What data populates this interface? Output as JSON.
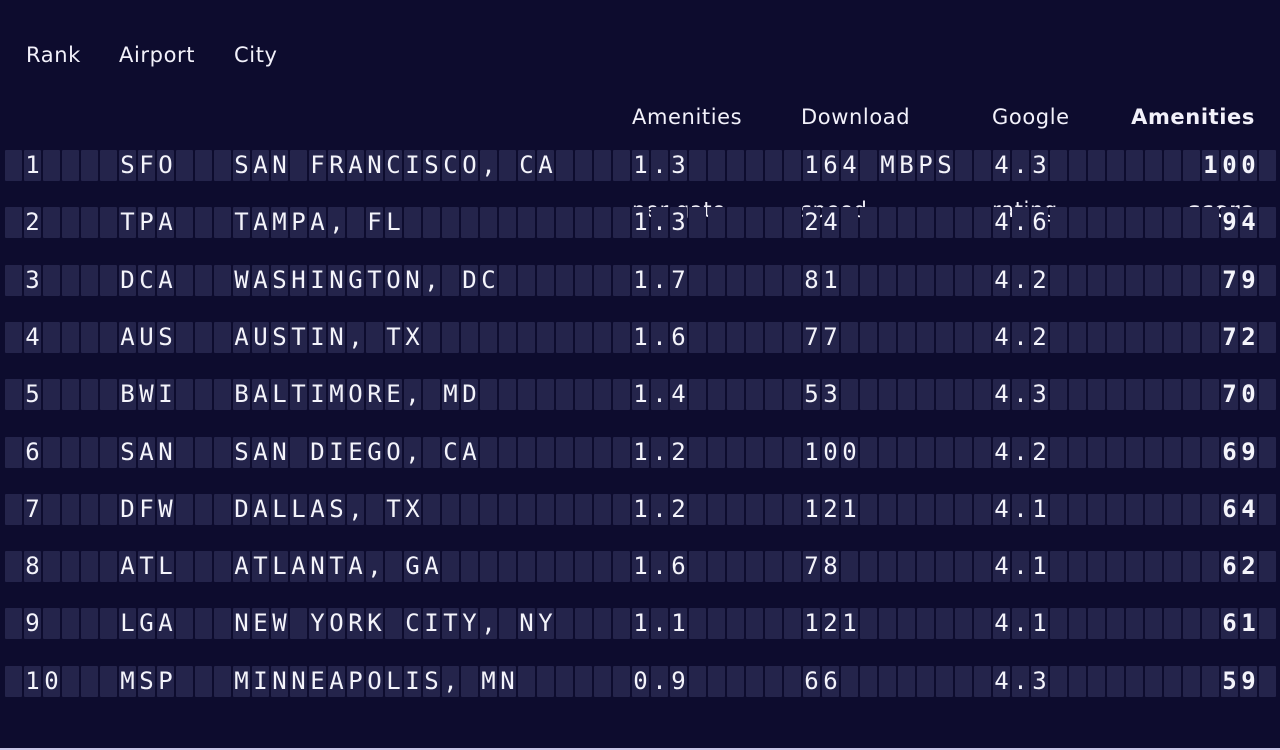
{
  "header": {
    "rank": "Rank",
    "airport": "Airport",
    "city": "City",
    "amenities_per_gate": [
      "Amenities",
      "per gate"
    ],
    "download_speed": [
      "Download",
      "speed"
    ],
    "google_rating": [
      "Google",
      "rating"
    ],
    "amenities_score": [
      "Amenities",
      "score"
    ]
  },
  "download_unit": "MBPS",
  "rows": [
    {
      "rank": "1",
      "airport": "SFO",
      "city": "SAN FRANCISCO, CA",
      "amenities_per_gate": "1.3",
      "download_speed": "164 MBPS",
      "google_rating": "4.3",
      "amenities_score": "100"
    },
    {
      "rank": "2",
      "airport": "TPA",
      "city": "TAMPA, FL",
      "amenities_per_gate": "1.3",
      "download_speed": "24",
      "google_rating": "4.6",
      "amenities_score": "94"
    },
    {
      "rank": "3",
      "airport": "DCA",
      "city": "WASHINGTON, DC",
      "amenities_per_gate": "1.7",
      "download_speed": "81",
      "google_rating": "4.2",
      "amenities_score": "79"
    },
    {
      "rank": "4",
      "airport": "AUS",
      "city": "AUSTIN, TX",
      "amenities_per_gate": "1.6",
      "download_speed": "77",
      "google_rating": "4.2",
      "amenities_score": "72"
    },
    {
      "rank": "5",
      "airport": "BWI",
      "city": "BALTIMORE, MD",
      "amenities_per_gate": "1.4",
      "download_speed": "53",
      "google_rating": "4.3",
      "amenities_score": "70"
    },
    {
      "rank": "6",
      "airport": "SAN",
      "city": "SAN DIEGO, CA",
      "amenities_per_gate": "1.2",
      "download_speed": "100",
      "google_rating": "4.2",
      "amenities_score": "69"
    },
    {
      "rank": "7",
      "airport": "DFW",
      "city": "DALLAS, TX",
      "amenities_per_gate": "1.2",
      "download_speed": "121",
      "google_rating": "4.1",
      "amenities_score": "64"
    },
    {
      "rank": "8",
      "airport": "ATL",
      "city": "ATLANTA, GA",
      "amenities_per_gate": "1.6",
      "download_speed": "78",
      "google_rating": "4.1",
      "amenities_score": "62"
    },
    {
      "rank": "9",
      "airport": "LGA",
      "city": "NEW YORK CITY, NY",
      "amenities_per_gate": "1.1",
      "download_speed": "121",
      "google_rating": "4.1",
      "amenities_score": "61"
    },
    {
      "rank": "10",
      "airport": "MSP",
      "city": "MINNEAPOLIS, MN",
      "amenities_per_gate": "0.9",
      "download_speed": "66",
      "google_rating": "4.3",
      "amenities_score": "59"
    }
  ],
  "colors": {
    "background": "#0d0c2e",
    "tile": "#24244b",
    "text": "#f4f4fb"
  }
}
